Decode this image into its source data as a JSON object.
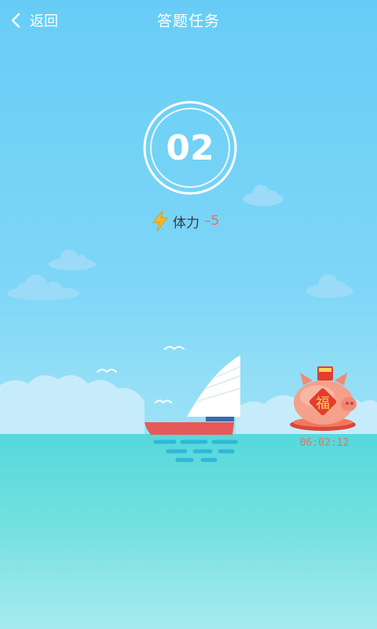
{
  "header": {
    "back_label": "返回",
    "title": "答题任务"
  },
  "question": {
    "number": "02"
  },
  "stamina": {
    "label": "体力",
    "value": "–5"
  },
  "bonus": {
    "icon": "fortune-piggy-bank-icon",
    "badge_char": "福",
    "timer": "06:02:12"
  },
  "colors": {
    "sky": "#67cdf6",
    "sea": "#56d8dc",
    "accent_red": "#e8705a",
    "boat_hull": "#e65a5a",
    "sail": "#ffffff"
  }
}
